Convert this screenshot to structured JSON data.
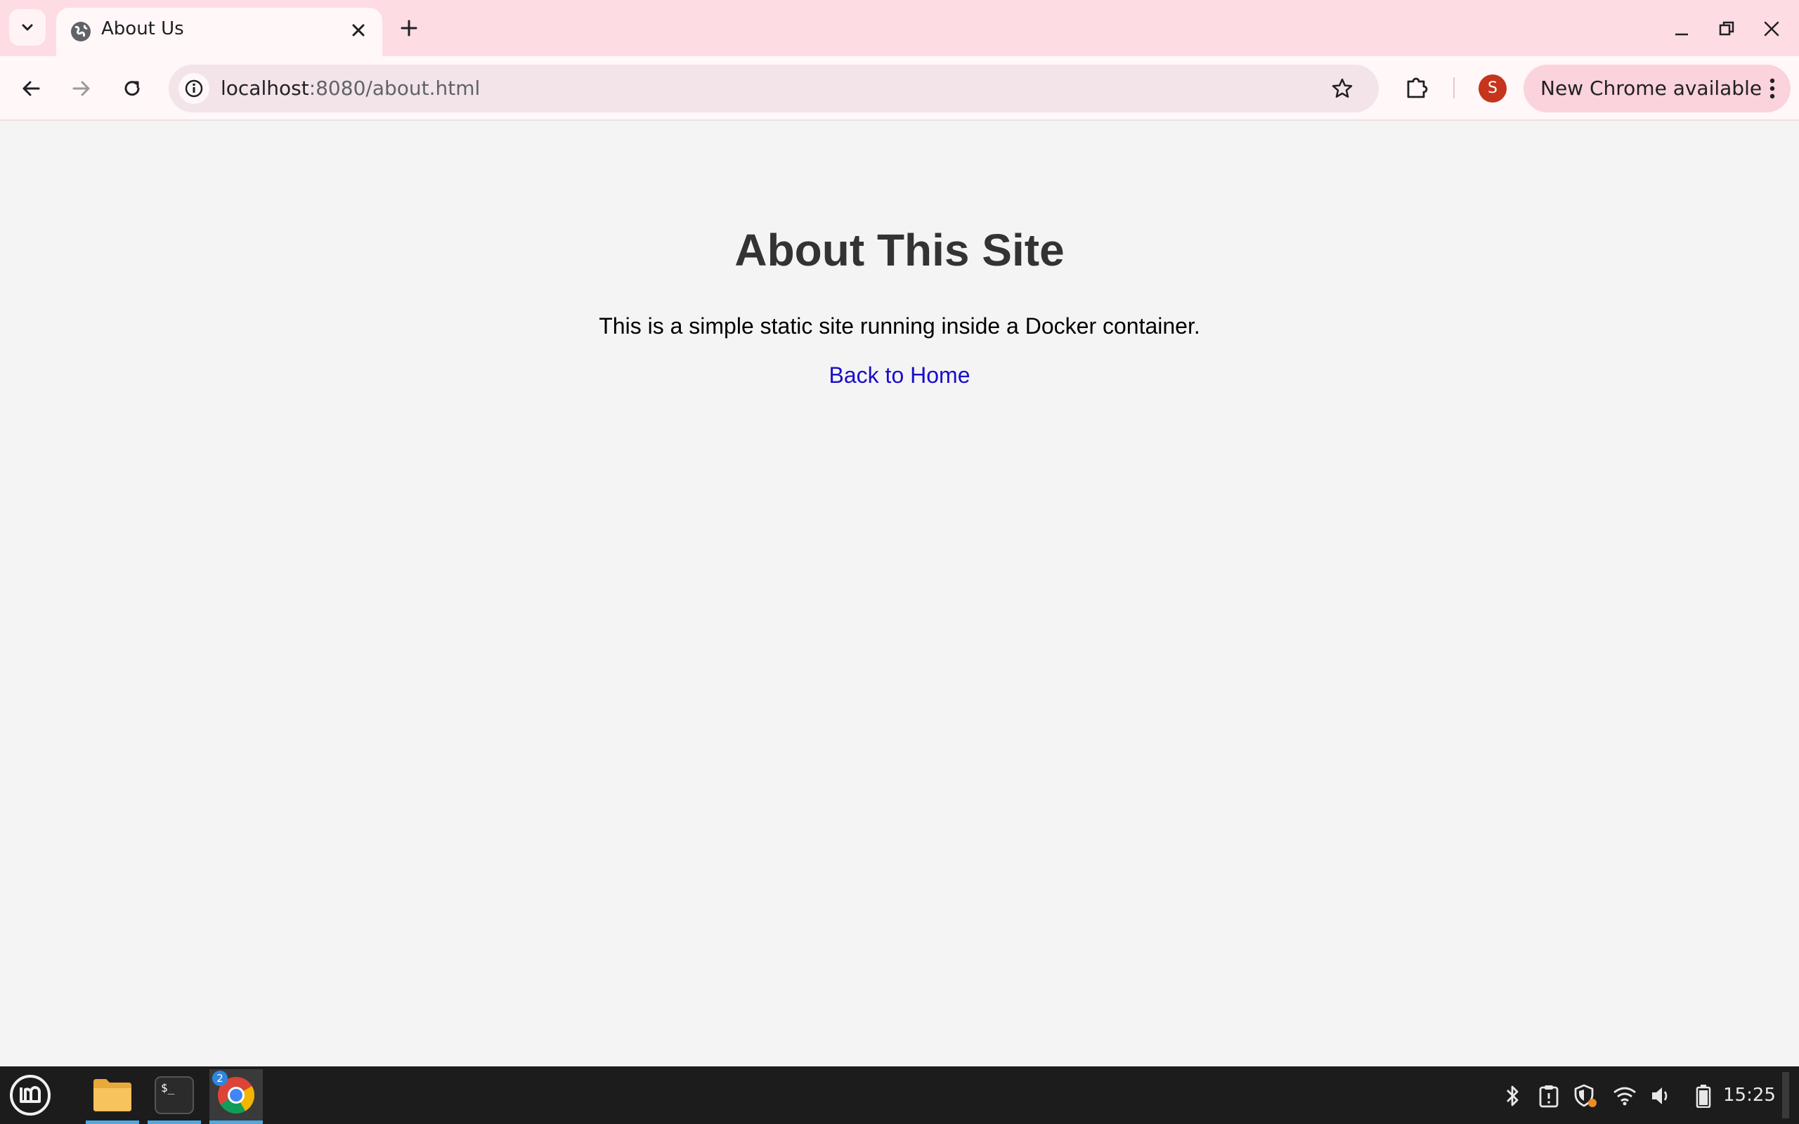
{
  "browser": {
    "tab": {
      "title": "About Us"
    },
    "omnibox": {
      "host": "localhost",
      "path": ":8080/about.html"
    },
    "profile_initial": "S",
    "update_chip": "New Chrome available"
  },
  "page": {
    "heading": "About This Site",
    "description": "This is a simple static site running inside a Docker container.",
    "link_text": "Back to Home"
  },
  "taskbar": {
    "clock": "15:25",
    "chrome_badge": "2"
  },
  "colors": {
    "tabstrip": "#fddce3",
    "toolbar": "#fff7f8",
    "page_bg": "#f4f4f4",
    "link": "#1a0dcc",
    "heading": "#333333",
    "taskbar": "#1c1c1c"
  },
  "icons": [
    "tab-search-icon",
    "globe-icon",
    "close-icon",
    "plus-icon",
    "minimize-icon",
    "restore-icon",
    "window-close-icon",
    "back-arrow-icon",
    "forward-arrow-icon",
    "reload-icon",
    "info-icon",
    "star-icon",
    "extensions-icon",
    "kebab-menu-icon",
    "mint-menu-icon",
    "folder-icon",
    "terminal-icon",
    "chrome-icon",
    "bluetooth-icon",
    "clipboard-icon",
    "shield-icon",
    "wifi-icon",
    "volume-icon",
    "battery-icon"
  ]
}
